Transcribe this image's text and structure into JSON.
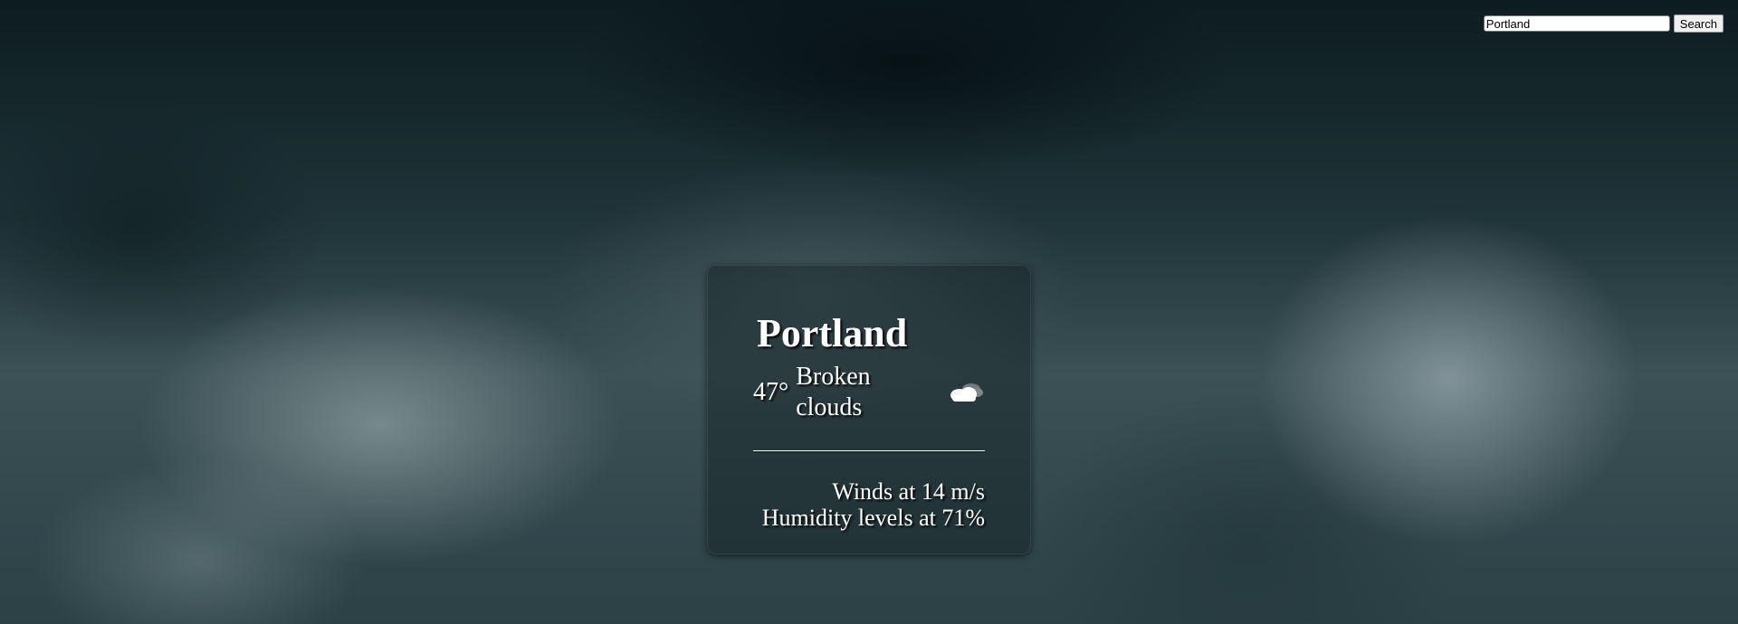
{
  "search": {
    "value": "Portland",
    "button_label": "Search"
  },
  "weather": {
    "city": "Portland",
    "temperature": "47°",
    "condition": "Broken clouds",
    "condition_icon": "cloud-sun-icon",
    "winds": "Winds at 14 m/s",
    "humidity": "Humidity levels at 71%"
  },
  "colors": {
    "text": "#ffffff",
    "card_background": "rgba(10, 20, 24, 0.38)"
  }
}
